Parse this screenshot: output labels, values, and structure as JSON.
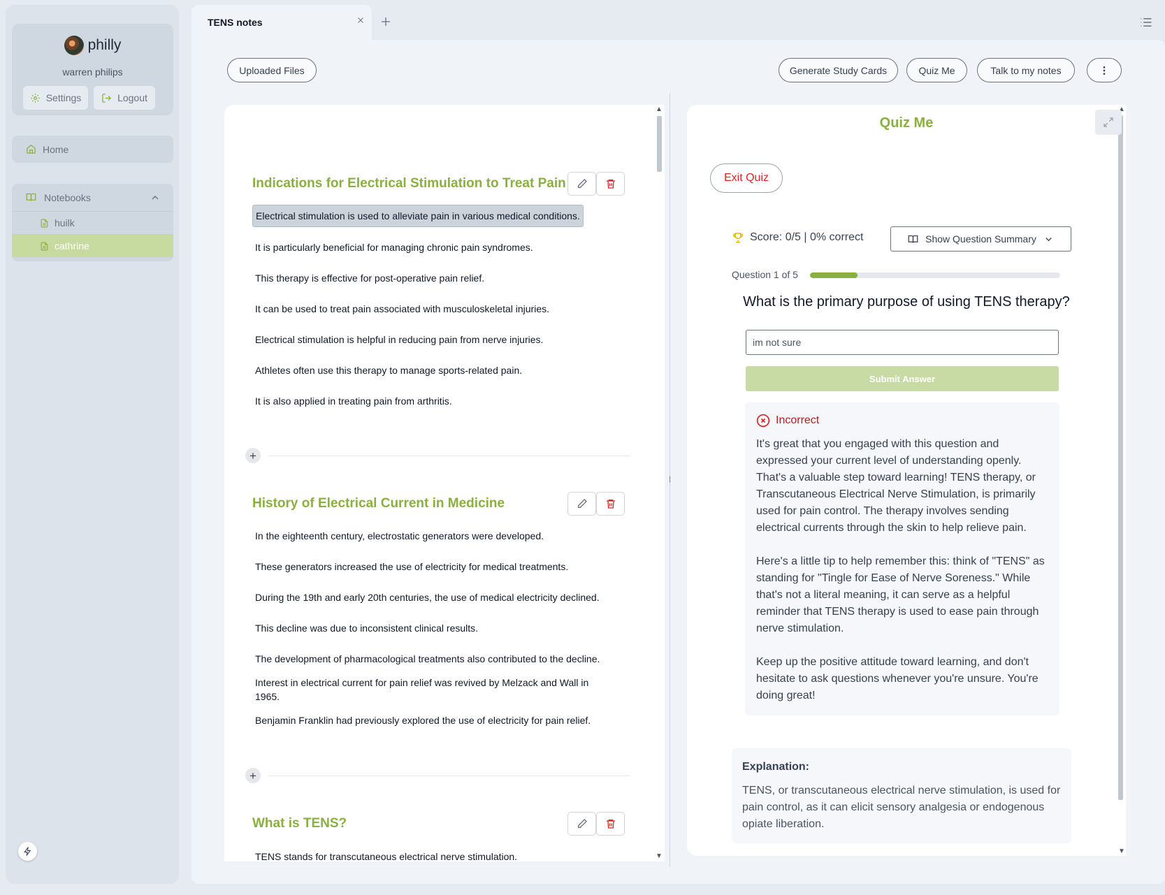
{
  "user": {
    "username": "philly",
    "full_name": "warren philips"
  },
  "profile_actions": {
    "settings": "Settings",
    "logout": "Logout"
  },
  "nav": {
    "home": "Home"
  },
  "notebooks": {
    "label": "Notebooks",
    "items": [
      {
        "label": "huilk",
        "active": false
      },
      {
        "label": "cathrine",
        "active": true
      }
    ]
  },
  "tabs": [
    {
      "label": "TENS notes"
    }
  ],
  "toolbar": {
    "uploaded_files": "Uploaded Files",
    "generate_cards": "Generate Study Cards",
    "quiz_me": "Quiz Me",
    "talk_notes": "Talk to my notes"
  },
  "notes": {
    "sections": [
      {
        "title": "Indications for Electrical Stimulation to Treat Pain",
        "lines": [
          "Electrical stimulation is used to alleviate pain in various medical conditions.",
          "It is particularly beneficial for managing chronic pain syndromes.",
          "This therapy is effective for post-operative pain relief.",
          "It can be used to treat pain associated with musculoskeletal injuries.",
          "Electrical stimulation is helpful in reducing pain from nerve injuries.",
          "Athletes often use this therapy to manage sports-related pain.",
          "It is also applied in treating pain from arthritis."
        ]
      },
      {
        "title": "History of Electrical Current in Medicine",
        "lines": [
          "In the eighteenth century, electrostatic generators were developed.",
          "These generators increased the use of electricity for medical treatments.",
          "During the 19th and early 20th centuries, the use of medical electricity declined.",
          "This decline was due to inconsistent clinical results.",
          "The development of pharmacological treatments also contributed to the decline.",
          "Interest in electrical current for pain relief was revived by Melzack and Wall in 1965.",
          "Benjamin Franklin had previously explored the use of electricity for pain relief."
        ]
      },
      {
        "title": "What is TENS?",
        "lines": [
          "TENS stands for transcutaneous electrical nerve stimulation."
        ]
      }
    ]
  },
  "quiz": {
    "title": "Quiz Me",
    "exit": "Exit Quiz",
    "score": "Score: 0/5 | 0% correct",
    "summary": "Show Question Summary",
    "question_number": "Question 1 of 5",
    "progress_fraction": 0.19,
    "question": "What is the primary purpose of using TENS therapy?",
    "answer_value": "im not sure",
    "submit": "Submit Answer",
    "feedback": {
      "status": "Incorrect",
      "paragraphs": [
        "It's great that you engaged with this question and expressed your current level of understanding openly. That's a valuable step toward learning! TENS therapy, or Transcutaneous Electrical Nerve Stimulation, is primarily used for pain control. The therapy involves sending electrical currents through the skin to help relieve pain.",
        "Here's a little tip to help remember this: think of \"TENS\" as standing for \"Tingle for Ease of Nerve Soreness.\" While that's not a literal meaning, it can serve as a helpful reminder that TENS therapy is used to ease pain through nerve stimulation.",
        "Keep up the positive attitude toward learning, and don't hesitate to ask questions whenever you're unsure. You're doing great!"
      ]
    },
    "explanation_label": "Explanation:",
    "explanation": "TENS, or transcutaneous electrical nerve stimulation, is used for pain control, as it can elicit sensory analgesia or endogenous opiate liberation."
  },
  "colors": {
    "accent": "#8ab040",
    "accent_light": "#c7dba0",
    "danger": "#dc2626",
    "background": "#e6ebf1"
  },
  "icons": [
    "avatar",
    "gear-icon",
    "logout-icon",
    "home-icon",
    "book-icon",
    "chevron-up-icon",
    "file-icon",
    "close-icon",
    "plus-icon",
    "list-icon",
    "more-vertical-icon",
    "pencil-icon",
    "trash-icon",
    "expand-icon",
    "trophy-icon",
    "chevron-down-icon",
    "x-circle-icon",
    "bolt-icon"
  ]
}
